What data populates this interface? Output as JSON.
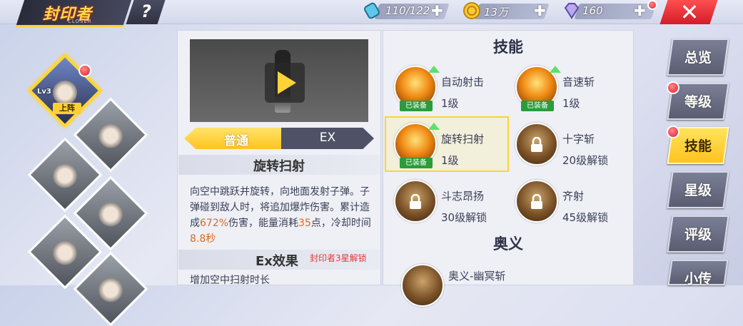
{
  "header": {
    "title": "封印者",
    "title_sub": "CLOSER",
    "help_label": "?",
    "close_label": "✕",
    "resources": [
      {
        "icon": "stamina-icon",
        "value": "110/122"
      },
      {
        "icon": "gold-coin-icon",
        "value": "13万"
      },
      {
        "icon": "diamond-icon",
        "value": "160"
      }
    ]
  },
  "roster": {
    "selected_level": "Lv3",
    "deploy_label": "上阵"
  },
  "skill_detail": {
    "tabs": [
      "普通",
      "EX"
    ],
    "name": "旋转扫射",
    "desc_1": "向空中跳跃并旋转，向地面发射子弹。子弹碰到敌人时，将追加爆炸伤害。累计造成",
    "damage": "672%",
    "desc_2": "伤害，能量消耗",
    "energy": "35",
    "desc_3": "点，冷却时间",
    "cooldown": "8.8秒",
    "ex_title": "Ex效果",
    "ex_lock": "封印者3星解锁",
    "ex_desc": "增加空中扫射时长"
  },
  "skills_panel": {
    "title": "技能",
    "equipped_label": "已装备",
    "skills": [
      {
        "name": "自动射击",
        "level": "1级"
      },
      {
        "name": "音速斩",
        "level": "1级"
      },
      {
        "name": "旋转扫射",
        "level": "1级"
      },
      {
        "name": "十字斩",
        "level": "20级解锁"
      },
      {
        "name": "斗志昂扬",
        "level": "30级解锁"
      },
      {
        "name": "齐射",
        "level": "45级解锁"
      }
    ],
    "ultimate_title": "奥义",
    "ultimate": {
      "name": "奥义-幽冥斩"
    }
  },
  "nav": [
    "总览",
    "等级",
    "技能",
    "星级",
    "评级",
    "小传"
  ],
  "colors": {
    "accent": "#ffc420",
    "equipped": "#2a9c3a",
    "alert": "#e01b2e",
    "highlight": "#e0691e"
  }
}
